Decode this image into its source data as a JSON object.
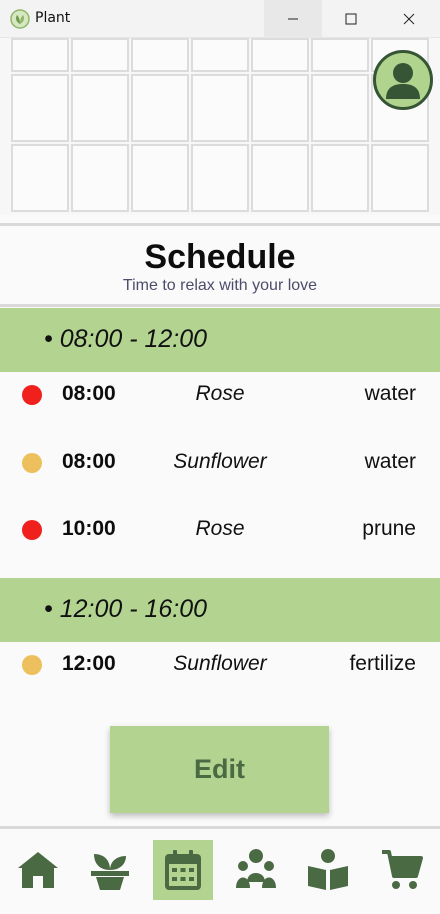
{
  "window": {
    "title": "Plant"
  },
  "schedule": {
    "title": "Schedule",
    "subtitle": "Time to relax with your love",
    "sections": [
      {
        "label": "• 08:00 - 12:00",
        "items": [
          {
            "time": "08:00",
            "plant": "Rose",
            "task": "water",
            "color": "#f0201d"
          },
          {
            "time": "08:00",
            "plant": "Sunflower",
            "task": "water",
            "color": "#ecc05c"
          },
          {
            "time": "10:00",
            "plant": "Rose",
            "task": "prune",
            "color": "#f0201d"
          }
        ]
      },
      {
        "label": "• 12:00 - 16:00",
        "items": [
          {
            "time": "12:00",
            "plant": "Sunflower",
            "task": "fertilize",
            "color": "#ecc05c"
          }
        ]
      }
    ],
    "edit_label": "Edit"
  },
  "nav": {
    "items": [
      {
        "icon": "home-icon"
      },
      {
        "icon": "plant-pot-icon"
      },
      {
        "icon": "calendar-icon",
        "active": true
      },
      {
        "icon": "community-icon"
      },
      {
        "icon": "reading-book-icon"
      },
      {
        "icon": "shopping-cart-icon"
      }
    ]
  },
  "colors": {
    "accent": "#b2d490",
    "icon_dark": "#4a6a43",
    "red_dot": "#f0201d",
    "yellow_dot": "#ecc05c"
  }
}
